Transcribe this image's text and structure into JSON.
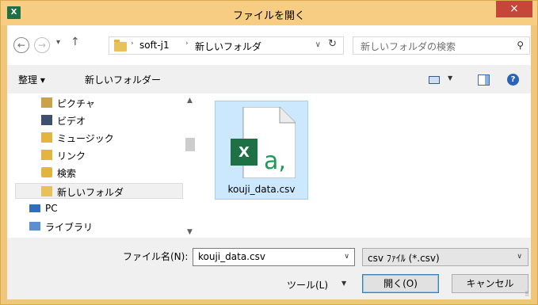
{
  "window": {
    "title": "ファイルを開く",
    "app_icon_text": "X",
    "close_glyph": "×"
  },
  "address": {
    "back_glyph": "←",
    "forward_glyph": "→",
    "recent_glyph": "▾",
    "up_glyph": "↑",
    "breadcrumbs": [
      "soft-j1",
      "新しいフォルダ"
    ],
    "sep_glyph": "›",
    "dropdown_glyph": "∨",
    "refresh_glyph": "↻",
    "search_placeholder": "新しいフォルダの検索",
    "search_glyph": "⚲"
  },
  "toolbar": {
    "organize_label": "整理 ▾",
    "new_folder_label": "新しいフォルダー",
    "view_dd_glyph": "▼",
    "help_glyph": "?"
  },
  "nav_pane": {
    "items": [
      {
        "label": "ピクチャ",
        "icon": "pictures-icon"
      },
      {
        "label": "ビデオ",
        "icon": "videos-icon"
      },
      {
        "label": "ミュージック",
        "icon": "music-icon"
      },
      {
        "label": "リンク",
        "icon": "links-icon"
      },
      {
        "label": "検索",
        "icon": "searches-icon"
      },
      {
        "label": "新しいフォルダ",
        "icon": "folder-icon"
      },
      {
        "label": "PC",
        "icon": "pc-icon"
      },
      {
        "label": "ライブラリ",
        "icon": "libraries-icon"
      }
    ],
    "scroll_up_glyph": "▲",
    "scroll_down_glyph": "▼"
  },
  "files": [
    {
      "name": "kouji_data.csv",
      "icon": "excel-csv-file-icon",
      "badge": "X",
      "glyph": "a,"
    }
  ],
  "bottom": {
    "filename_label": "ファイル名(N):",
    "filename_value": "kouji_data.csv",
    "dropdown_glyph": "∨",
    "filetype_value": "csv ﾌｧｲﾙ (*.csv)",
    "tools_label": "ツール(L)",
    "tools_dd_glyph": "▼",
    "open_label": "開く(O)",
    "cancel_label": "キャンセル",
    "grip_glyph": "⠿"
  },
  "colors": {
    "titlebar": "#f6cd82",
    "close": "#c7463a",
    "selection": "#cce8ff",
    "excel_green": "#1e7145"
  }
}
